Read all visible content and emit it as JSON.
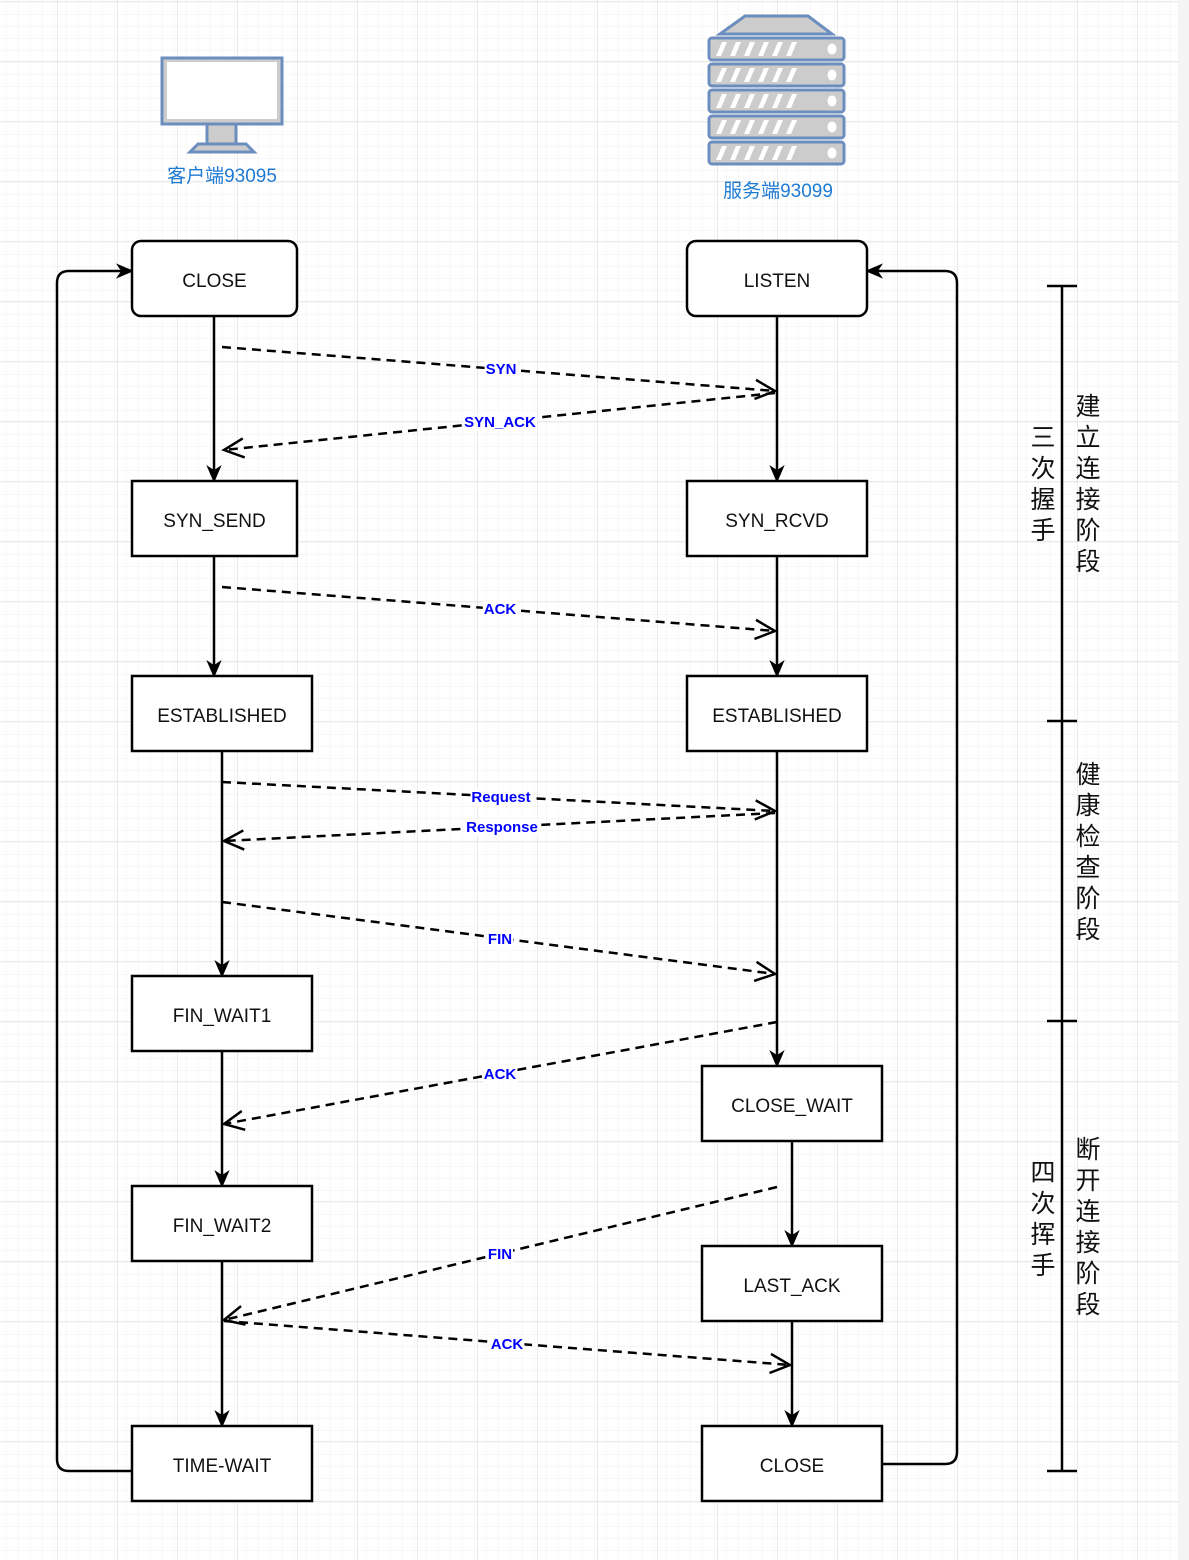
{
  "client": {
    "label": "客户端93095",
    "icon": "desktop-monitor-icon"
  },
  "server": {
    "label": "服务端93099",
    "icon": "server-rack-icon"
  },
  "client_states": [
    "CLOSE",
    "SYN_SEND",
    "ESTABLISHED",
    "FIN_WAIT1",
    "FIN_WAIT2",
    "TIME-WAIT"
  ],
  "server_states": [
    "LISTEN",
    "SYN_RCVD",
    "ESTABLISHED",
    "CLOSE_WAIT",
    "LAST_ACK",
    "CLOSE"
  ],
  "messages": [
    {
      "label": "SYN",
      "direction": "client-to-server"
    },
    {
      "label": "SYN_ACK",
      "direction": "server-to-client"
    },
    {
      "label": "ACK",
      "direction": "client-to-server"
    },
    {
      "label": "Request",
      "direction": "client-to-server"
    },
    {
      "label": "Response",
      "direction": "server-to-client"
    },
    {
      "label": "FIN",
      "direction": "client-to-server"
    },
    {
      "label": "ACK",
      "direction": "server-to-client"
    },
    {
      "label": "FIN",
      "direction": "server-to-client"
    },
    {
      "label": "ACK",
      "direction": "client-to-server"
    }
  ],
  "phases": [
    {
      "name": "建立连接阶段",
      "sub": "三次握手"
    },
    {
      "name": "健康检查阶段",
      "sub": ""
    },
    {
      "name": "断开连接阶段",
      "sub": "四次挥手"
    }
  ],
  "colors": {
    "message_label": "#0000ff",
    "host_label": "#1e7bd4",
    "icon_stroke": "#6c8ebf",
    "icon_fill": "#cccccc"
  }
}
